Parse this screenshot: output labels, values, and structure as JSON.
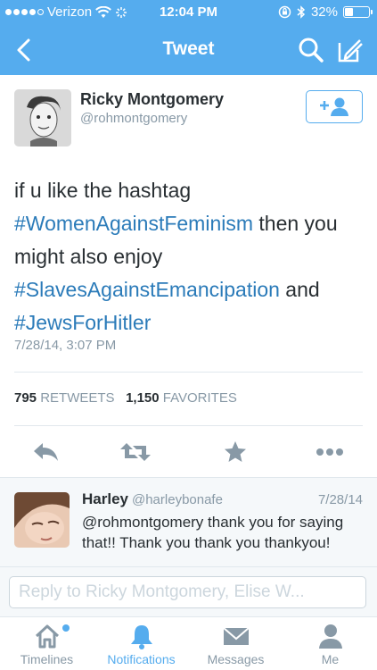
{
  "status_bar": {
    "carrier": "Verizon",
    "time": "12:04 PM",
    "battery": "32%",
    "battery_level": 0.32,
    "icons": [
      "wifi-icon",
      "activity-icon",
      "rotation-lock-icon",
      "bluetooth-icon"
    ]
  },
  "nav": {
    "title": "Tweet",
    "icons": [
      "back-chevron-icon",
      "search-icon",
      "compose-icon"
    ]
  },
  "tweet": {
    "author_name": "Ricky Montgomery",
    "author_handle": "@rohmontgomery",
    "text_parts": {
      "p1": "if u like the hashtag ",
      "h1": "#WomenAgainstFeminism",
      "p2": " then you might also enjoy ",
      "h2": "#SlavesAgainstEmancipation",
      "p3": " and ",
      "h3": "#JewsForHitler"
    },
    "timestamp": "7/28/14, 3:07 PM",
    "retweets_count": "795",
    "retweets_label": "RETWEETS",
    "favorites_count": "1,150",
    "favorites_label": "FAVORITES"
  },
  "actions": [
    "reply-icon",
    "retweet-icon",
    "favorite-star-icon",
    "more-icon"
  ],
  "reply": {
    "name": "Harley",
    "handle": "@harleybonafe",
    "date": "7/28/14",
    "text": "@rohmontgomery thank you for saying that!! Thank you thank you thankyou!"
  },
  "composer": {
    "placeholder": "Reply to Ricky Montgomery, Elise W..."
  },
  "tabs": [
    {
      "label": "Timelines",
      "icon": "home-icon"
    },
    {
      "label": "Notifications",
      "icon": "bell-icon"
    },
    {
      "label": "Messages",
      "icon": "envelope-icon"
    },
    {
      "label": "Me",
      "icon": "person-icon"
    }
  ],
  "colors": {
    "brand": "#55acee",
    "hashtag": "#2b7bb9",
    "muted": "#8899a6",
    "text": "#292f33"
  }
}
